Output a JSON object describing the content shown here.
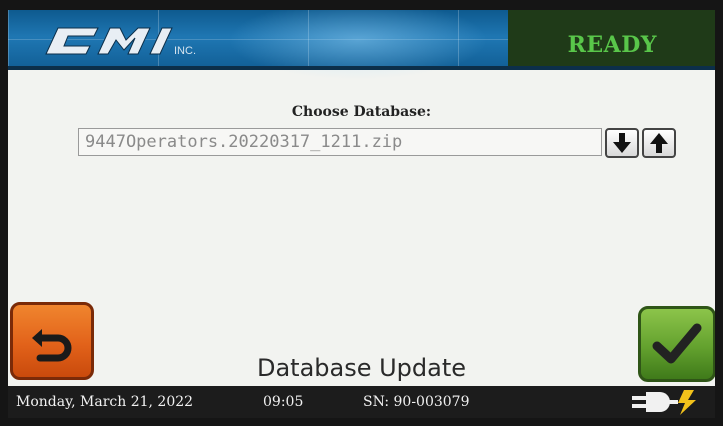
{
  "header": {
    "logo_text": "CMI INC.",
    "status": "READY",
    "status_color": "#59c64a"
  },
  "main": {
    "field_label": "Choose Database:",
    "database_value": "9447Operators.20220317_1211.zip",
    "down_button_icon": "down-arrow-icon",
    "up_button_icon": "up-arrow-icon",
    "back_button_icon": "back-arrow-icon",
    "confirm_button_icon": "checkmark-icon",
    "page_title": "Database Update"
  },
  "footer": {
    "date": "Monday, March 21, 2022",
    "time": "09:05",
    "serial": "SN: 90-003079",
    "power_icon": "ac-power-plug-icon"
  }
}
